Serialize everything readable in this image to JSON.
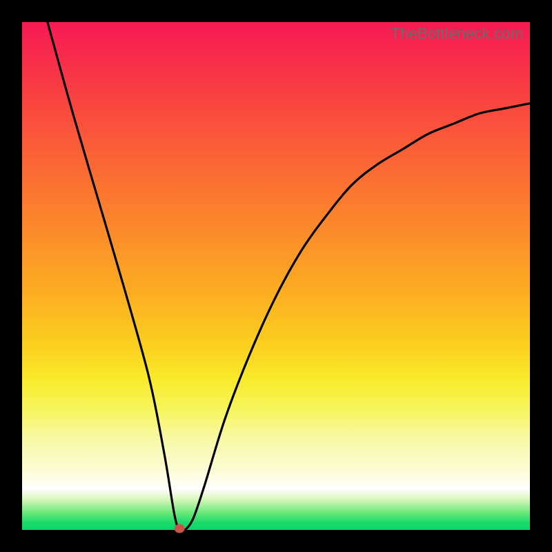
{
  "attribution": "TheBottleneck.com",
  "chart_data": {
    "type": "line",
    "title": "",
    "xlabel": "",
    "ylabel": "",
    "xlim": [
      0,
      100
    ],
    "ylim": [
      0,
      100
    ],
    "series": [
      {
        "name": "bottleneck-curve",
        "x": [
          5,
          10,
          15,
          20,
          25,
          28,
          30,
          31,
          32,
          33,
          34,
          36,
          40,
          45,
          50,
          55,
          60,
          65,
          70,
          75,
          80,
          85,
          90,
          95,
          100
        ],
        "values": [
          100,
          82,
          65,
          48,
          30,
          15,
          3,
          0,
          0,
          1,
          3,
          9,
          22,
          35,
          46,
          55,
          62,
          68,
          72,
          75,
          78,
          80,
          82,
          83,
          84
        ]
      }
    ],
    "marker": {
      "x": 31,
      "y": 0,
      "color": "#c9534a"
    },
    "background_gradient": {
      "stops": [
        {
          "pos": 0,
          "color": "#f71a53"
        },
        {
          "pos": 18,
          "color": "#f94b3e"
        },
        {
          "pos": 42,
          "color": "#fc8d2a"
        },
        {
          "pos": 64,
          "color": "#fbd11f"
        },
        {
          "pos": 82,
          "color": "#f8f9a5"
        },
        {
          "pos": 92,
          "color": "#ffffff"
        },
        {
          "pos": 100,
          "color": "#08d66a"
        }
      ]
    }
  }
}
